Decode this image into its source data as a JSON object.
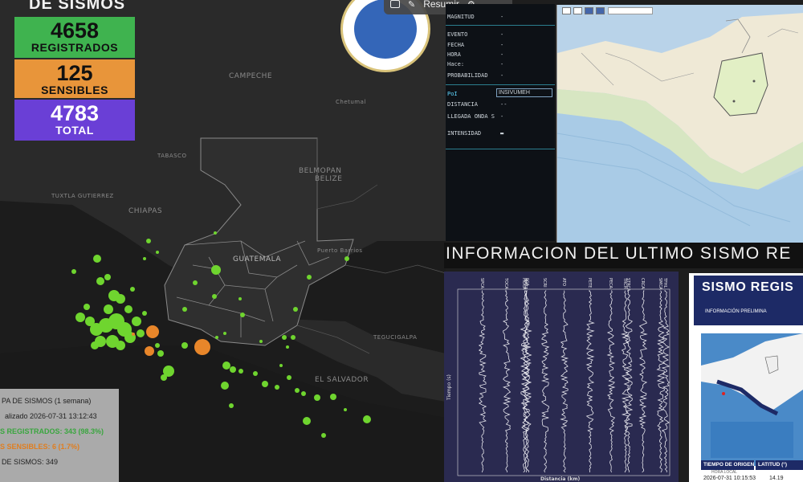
{
  "map": {
    "title": "DE SISMOS",
    "stats": {
      "registered_value": "4658",
      "registered_label": "REGISTRADOS",
      "sensible_value": "125",
      "sensible_label": "SENSIBLES",
      "total_value": "4783",
      "total_label": "TOTAL"
    },
    "labels": {
      "campeche": "CAMPECHE",
      "chiapas": "CHIAPAS",
      "guatemala": "GUATEMALA",
      "belmopan": "BELMOPAN",
      "belize": "BELIZE",
      "el_salvador": "EL SALVADOR",
      "tuxtla": "TUXTLA GUTIERREZ",
      "tegucigalpa": "TEGUCIGALPA",
      "puerto_barrios": "Puerto Barrios",
      "chetumal": "Chetumal",
      "tabasco": "TABASCO"
    },
    "legend": {
      "title": "PA DE SISMOS (1 semana)",
      "updated": "alizado 2026-07-31 13:12:43",
      "registered": "S REGISTRADOS: 343 (98.3%)",
      "sensible": "S SENSIBLES: 6 (1.7%)",
      "total": " DE SISMOS: 349"
    }
  },
  "toolbar": {
    "resumir_label": "Resumir"
  },
  "info": {
    "rows": {
      "magnitud": "MAGNITUD",
      "evento": "EVENTO",
      "fecha": "FECHA",
      "hora": "HORA",
      "hace": "Hace:",
      "probabilidad": "PROBABILIDAD",
      "poi": "PoI",
      "distancia": "DISTANCIA",
      "llegada": "LLEGADA ONDA S",
      "intensidad": "INTENSIDAD"
    },
    "values": {
      "dash": "-",
      "distancia": "--",
      "llegada": "-",
      "intensidad": "▬"
    },
    "poi_value": "INSIVUMEH"
  },
  "headline": "INFORMACION DEL ULTIMO SISMO RE",
  "seismogram": {
    "xlabel": "Distancia (km)",
    "ylabel": "Tiempo (s)",
    "stations": [
      "SPCA",
      "TOCA",
      "HOCA",
      "MPCA",
      "SCA",
      "SCRI",
      "ATO",
      "PETE",
      "PECA",
      "TRCH",
      "STRCA",
      "CRCA",
      "SMCA",
      "TFHL"
    ]
  },
  "report": {
    "title": "SISMO REGIS",
    "subtitle": "INFORMACIÓN PRELIMINA",
    "col1_header": "TIEMPO DE ORIGEN",
    "col1_sub": "HORA LOCAL",
    "col1_value": "2026-07-31 10:15:53",
    "col2_header": "LATITUD (°)",
    "col2_value": "14.19"
  },
  "colors": {
    "registered": "#3fb34f",
    "sensible": "#e8953a",
    "total": "#6a3fd6",
    "quake_green": "#6fd52f",
    "quake_orange": "#e8862a"
  }
}
